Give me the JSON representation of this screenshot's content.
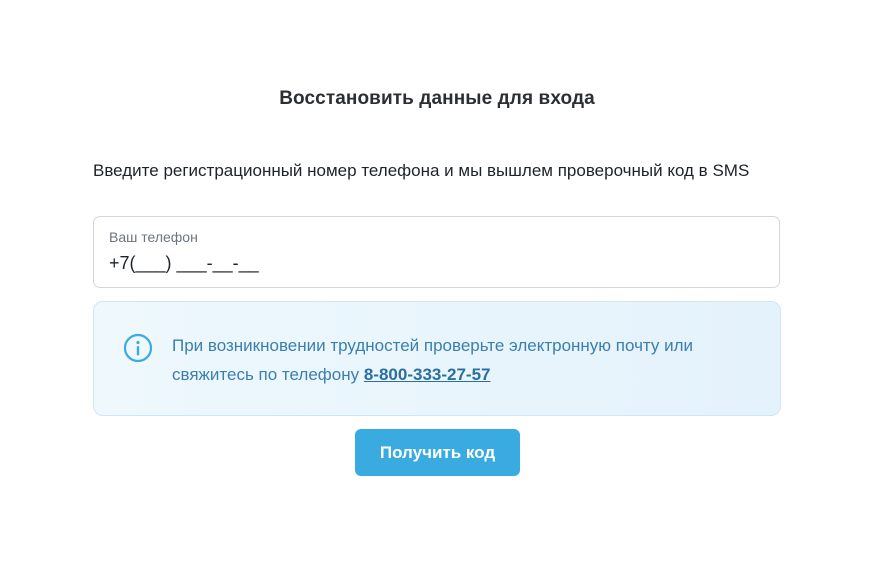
{
  "page": {
    "title": "Восстановить данные для входа",
    "instruction": "Введите регистрационный номер телефона и мы вышлем проверочный код в SMS"
  },
  "phone_field": {
    "label": "Ваш телефон",
    "value": "+7(___) ___-__-__"
  },
  "info": {
    "icon": "info-icon",
    "text": "При возникновении трудностей проверьте электронную почту или свяжитесь по телефону ",
    "phone_link": "8-800-333-27-57"
  },
  "submit": {
    "label": "Получить код",
    "color": "#3aabe0"
  }
}
